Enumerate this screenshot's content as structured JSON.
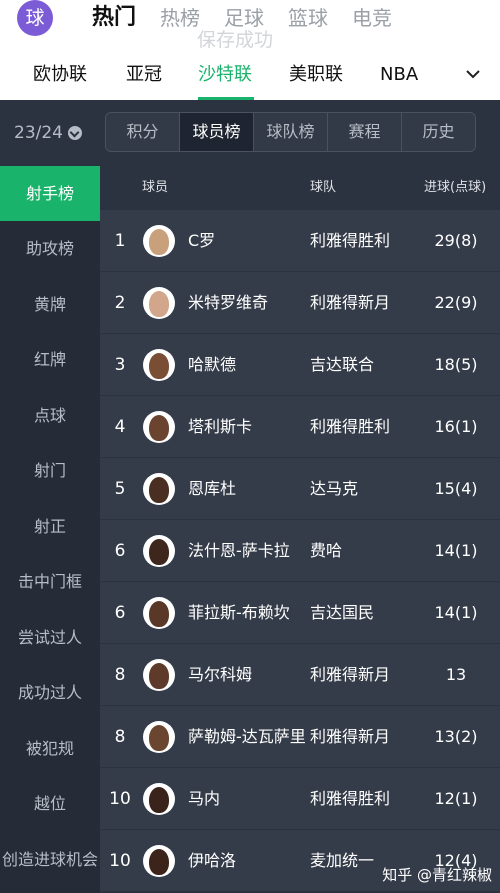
{
  "app": {
    "logo_text": "球",
    "toast": "保存成功"
  },
  "top_tabs": [
    {
      "label": "热门",
      "active": true
    },
    {
      "label": "热榜",
      "active": false
    },
    {
      "label": "足球",
      "active": false
    },
    {
      "label": "篮球",
      "active": false
    },
    {
      "label": "电竞",
      "active": false
    }
  ],
  "leagues": [
    {
      "label": "欧协联",
      "active": false
    },
    {
      "label": "亚冠",
      "active": false
    },
    {
      "label": "沙特联",
      "active": true
    },
    {
      "label": "美职联",
      "active": false
    },
    {
      "label": "NBA",
      "active": false
    }
  ],
  "season": {
    "label": "23/24"
  },
  "sub_tabs": [
    {
      "label": "积分",
      "active": false
    },
    {
      "label": "球员榜",
      "active": true
    },
    {
      "label": "球队榜",
      "active": false
    },
    {
      "label": "赛程",
      "active": false
    },
    {
      "label": "历史",
      "active": false
    }
  ],
  "side_menu": [
    {
      "label": "射手榜",
      "active": true
    },
    {
      "label": "助攻榜",
      "active": false
    },
    {
      "label": "黄牌",
      "active": false
    },
    {
      "label": "红牌",
      "active": false
    },
    {
      "label": "点球",
      "active": false
    },
    {
      "label": "射门",
      "active": false
    },
    {
      "label": "射正",
      "active": false
    },
    {
      "label": "击中门框",
      "active": false
    },
    {
      "label": "尝试过人",
      "active": false
    },
    {
      "label": "成功过人",
      "active": false
    },
    {
      "label": "被犯规",
      "active": false
    },
    {
      "label": "越位",
      "active": false
    },
    {
      "label": "创造进球机会",
      "active": false
    }
  ],
  "table": {
    "headers": {
      "player": "球员",
      "team": "球队",
      "goals": "进球(点球)"
    },
    "rows": [
      {
        "rank": "1",
        "name": "C罗",
        "team": "利雅得胜利",
        "goals": "29(8)",
        "skin": "#c9a07c"
      },
      {
        "rank": "2",
        "name": "米特罗维奇",
        "team": "利雅得新月",
        "goals": "22(9)",
        "skin": "#d2a68a"
      },
      {
        "rank": "3",
        "name": "哈默德",
        "team": "吉达联合",
        "goals": "18(5)",
        "skin": "#7a4e34"
      },
      {
        "rank": "4",
        "name": "塔利斯卡",
        "team": "利雅得胜利",
        "goals": "16(1)",
        "skin": "#6b4430"
      },
      {
        "rank": "5",
        "name": "恩库杜",
        "team": "达马克",
        "goals": "15(4)",
        "skin": "#4a2e22"
      },
      {
        "rank": "6",
        "name": "法什恩-萨卡拉",
        "team": "费哈",
        "goals": "14(1)",
        "skin": "#3e261c"
      },
      {
        "rank": "6",
        "name": "菲拉斯-布赖坎",
        "team": "吉达国民",
        "goals": "14(1)",
        "skin": "#5a3828"
      },
      {
        "rank": "8",
        "name": "马尔科姆",
        "team": "利雅得新月",
        "goals": "13",
        "skin": "#5e3a2a"
      },
      {
        "rank": "8",
        "name": "萨勒姆-达瓦萨里",
        "team": "利雅得新月",
        "goals": "13(2)",
        "skin": "#6a4530"
      },
      {
        "rank": "10",
        "name": "马内",
        "team": "利雅得胜利",
        "goals": "12(1)",
        "skin": "#3a231a"
      },
      {
        "rank": "10",
        "name": "伊哈洛",
        "team": "麦加统一",
        "goals": "12(4)",
        "skin": "#3c241b"
      }
    ]
  },
  "watermark": "知乎 @青红辣椒"
}
